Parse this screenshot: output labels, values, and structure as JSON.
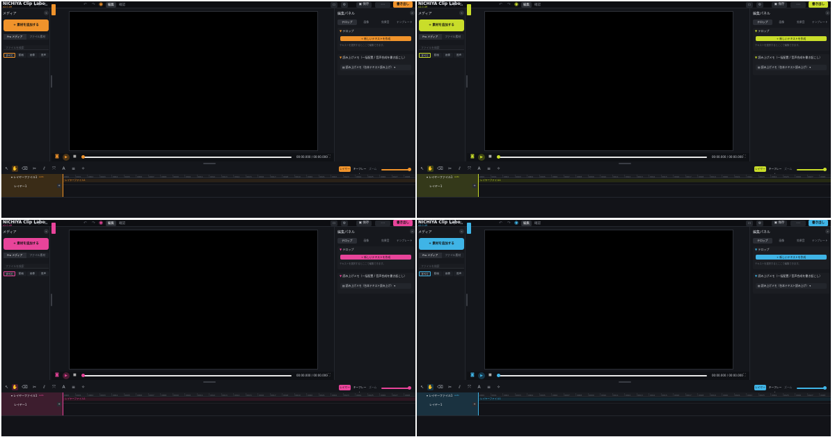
{
  "app": {
    "title": "NICHIYA Clip Labo",
    "version": "v2.0.49",
    "home": "ホーム"
  },
  "topbar": {
    "mode_edit": "編集",
    "mode_view": "確認",
    "save": "保存",
    "more": "⋯",
    "export": "書き出し"
  },
  "media_panel": {
    "title": "メディア",
    "add_button": "+ 素材を追加する",
    "source_tabs": [
      "Pro メディア",
      "ファイル素材"
    ],
    "search_placeholder": "ファイルを検索",
    "filters": [
      "すべて",
      "動画",
      "画像",
      "音声"
    ]
  },
  "player": {
    "timecode": "00:00.000 / 00:00.000"
  },
  "edit_panel": {
    "title": "編集パネル",
    "tabs": [
      "テロップ",
      "画像",
      "効果音",
      "テンプレート"
    ],
    "section1_title": "テロップ",
    "add_text_button": "+ 新しいテキストを作成",
    "help": "テキストを選択するとここで編集できます。",
    "section2_title": "読み上げメモ（一括配置 / 音声合成を書き起こし）",
    "memo_item": "読み上げメモ（台本テキスト読み上げ）"
  },
  "toolbar": {
    "layer_button": "レイヤー",
    "keyframe_button": "キーフレーム",
    "zoom_label": "ズーム"
  },
  "timeline": {
    "file_track": "レイヤーファイル1",
    "badge": "auto",
    "layer_track": "レイヤー1",
    "ruler_ticks": [
      "0000",
      "0001",
      "0002",
      "0003",
      "0004",
      "0005",
      "0006",
      "0007",
      "0008",
      "0009",
      "0010",
      "0011",
      "0012",
      "0013",
      "0014",
      "0015",
      "0016",
      "0017",
      "0018",
      "0019",
      "0020",
      "0021",
      "0022",
      "0023",
      "0024",
      "0025",
      "0026",
      "0027",
      "0028"
    ]
  },
  "themes": [
    {
      "name": "orange",
      "accent": "#f0932b"
    },
    {
      "name": "lime",
      "accent": "#c9dd2a"
    },
    {
      "name": "pink",
      "accent": "#e8449a"
    },
    {
      "name": "sky",
      "accent": "#3fb4e6"
    }
  ]
}
